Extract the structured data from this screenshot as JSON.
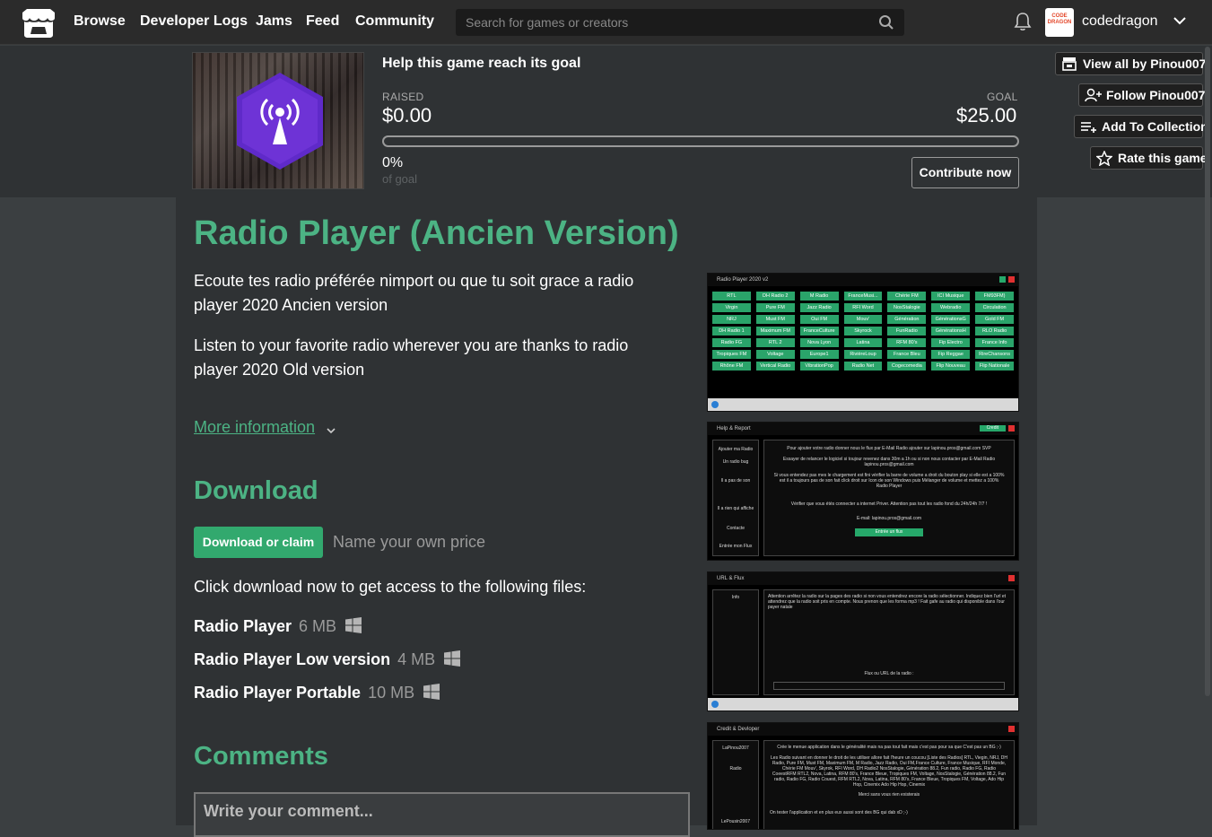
{
  "nav": {
    "links": [
      "Browse",
      "Developer Logs",
      "Jams",
      "Feed",
      "Community"
    ],
    "search_placeholder": "Search for games or creators",
    "username": "codedragon",
    "avatar_text": "CODE DRAGON"
  },
  "goal": {
    "title": "Help this game reach its goal",
    "raised_label": "RAISED",
    "raised_value": "$0.00",
    "goal_label": "GOAL",
    "goal_value": "$25.00",
    "progress_fraction": 0.0,
    "percent": "0%",
    "of_goal": "of goal",
    "contribute": "Contribute now"
  },
  "side_buttons": {
    "view_all": "View all by Pinou007",
    "follow": "Follow Pinou007",
    "add_collection": "Add To Collection",
    "rate": "Rate this game"
  },
  "game": {
    "title": "Radio Player (Ancien Version)",
    "desc_fr": "Ecoute tes radio préférée nimport ou que tu soit grace a radio player 2020 Ancien version",
    "desc_en": "Listen to your favorite radio wherever you are thanks to radio player 2020 Old version",
    "more_info": "More information"
  },
  "download": {
    "heading": "Download",
    "button": "Download or claim",
    "name_price": "Name your own price",
    "click_text": "Click download now to get access to the following files:",
    "files": [
      {
        "name": "Radio Player",
        "size": "6 MB",
        "platform": "windows-icon"
      },
      {
        "name": "Radio Player Low version",
        "size": "4 MB",
        "platform": "windows-icon"
      },
      {
        "name": "Radio Player Portable",
        "size": "10 MB",
        "platform": "windows-icon"
      }
    ]
  },
  "comments": {
    "heading": "Comments",
    "placeholder": "Write your comment..."
  },
  "screenshots": {
    "s1": {
      "title": "Radio Player 2020 v2",
      "stations": [
        "RTL",
        "DH Radio 2",
        "M Radio",
        "FranceMusi...",
        "Chérie FM",
        "ICI Musique",
        "FM93FM)",
        "Virgin",
        "Pure FM",
        "Jazz Radio",
        "RFI Word",
        "NosStalogie",
        "Webradio",
        "Circulation",
        "NRJ",
        "Must FM",
        "Oui FM",
        "Mouv'",
        "Génération",
        "GénérationsG",
        "Gold FM",
        "DH Radio 1",
        "Maximum FM",
        "FranceCulture",
        "Skyrock",
        "FunRadio",
        "GénérationsH",
        "RLO Radio",
        "Radio FG",
        "RTL 2",
        "Nova Lyon",
        "Latina",
        "RFM 80's",
        "Fip Electro",
        "France Info",
        "Tropiques FM",
        "Voltage",
        "Europe1",
        "RivièreLoup",
        "France Bleu",
        "Fip Reggae",
        "RireChansons",
        "Rhône FM",
        "Vertical Radio",
        "VibrationPop",
        "Radio Net",
        "Cogecomedia",
        "Flip Nouveau",
        "Flip Nationale"
      ]
    },
    "s2": {
      "title": "Help & Report",
      "credit": "Credit",
      "menu": [
        "Ajouter ma Radio",
        "Un radio bug",
        "Il a pas de son",
        "Il a rien qui affiche",
        "Contacte",
        "Entrée mon Flux"
      ],
      "line1": "Pour ajouter votre radio donner nous le flux par E-Mail  Radio ajouter sur lapinou.pros@gmail.com  SVP",
      "line2": "Essayer de relancer le logiciel si toujour revenez dans 30m a 1h ou si non nous contacter par E-Mail Radio lapinou.pros@gmail.com",
      "line3": "Si vous entendez pas mes le chargement est fini vérifier la barre de volume a droit du bouton play si elle est a 100% est il a toujours pas de son fait click droit sur Icon de son Windows  puis Mélanger de volume et mettez a 100% Radio Player",
      "line4": "Vérifier que vous étés connecter a internet Priver. Attention pas tout les radio fond du 24h/24h 7/7 !",
      "line5": "E-mail: lapinou.pros@gmail.com",
      "button": "Entrée un flux"
    },
    "s3": {
      "title": "URL & Flux",
      "side": "Info",
      "line1": "Attention arrêtez la radio sur la pages des radio si non vous entendrez encore la radio sélectionner. Indiquez bien l'url et attendrez que la radio soit pris en compte. Nous prenon que les forma mp3 !    Fait gafe au radio qui disponible dans l'our payer natale",
      "line2": "Flux ou URL de la radio :"
    },
    "s4": {
      "title": "Credit & Devloper",
      "side": [
        "LaPinou2007",
        "Radio",
        "LePousin2007"
      ],
      "line1": "Crée le menue application dans le généralité mais na pas tout fait mais c'est pas pour sa que  C'est pas un BG ;-)",
      "line2": "Les Radio suivant en donner le droit de les utiliser allore fait l'heure un coucou  [Liste des Radios] RTL, Viegin, NRJ, DH Radio, Pure FM, Must FM, Maximum FM, M Radio, Jazz Radio, Oui FM,France Culture, France Musique, RFI Monde, Chérie FM Mouv', Skyrok, RFI Word, DH Radio2 NosStalogie, Génération 88.2, Fun radio, Radio FG, Radio CoeestRFM RTL2, Nova, Latina, RFM 80's, France Bleue, Tropiques FM, Voltage, NosStalogie, Génération 88.2, Fun radio, Radio FG, Radio Couest, RFM RTL2, Nova, Latina, RFM 80's, France Bleue, Tropiques FM, Voltage, Ado Hip Hop, Cinemix Ado Hip Hop, Cinemix",
      "line3": "Merci sans vous rien existerais",
      "line4": "On tester l'application et en plus eux aussi sont des BG qui dab xD  ;-)"
    }
  }
}
